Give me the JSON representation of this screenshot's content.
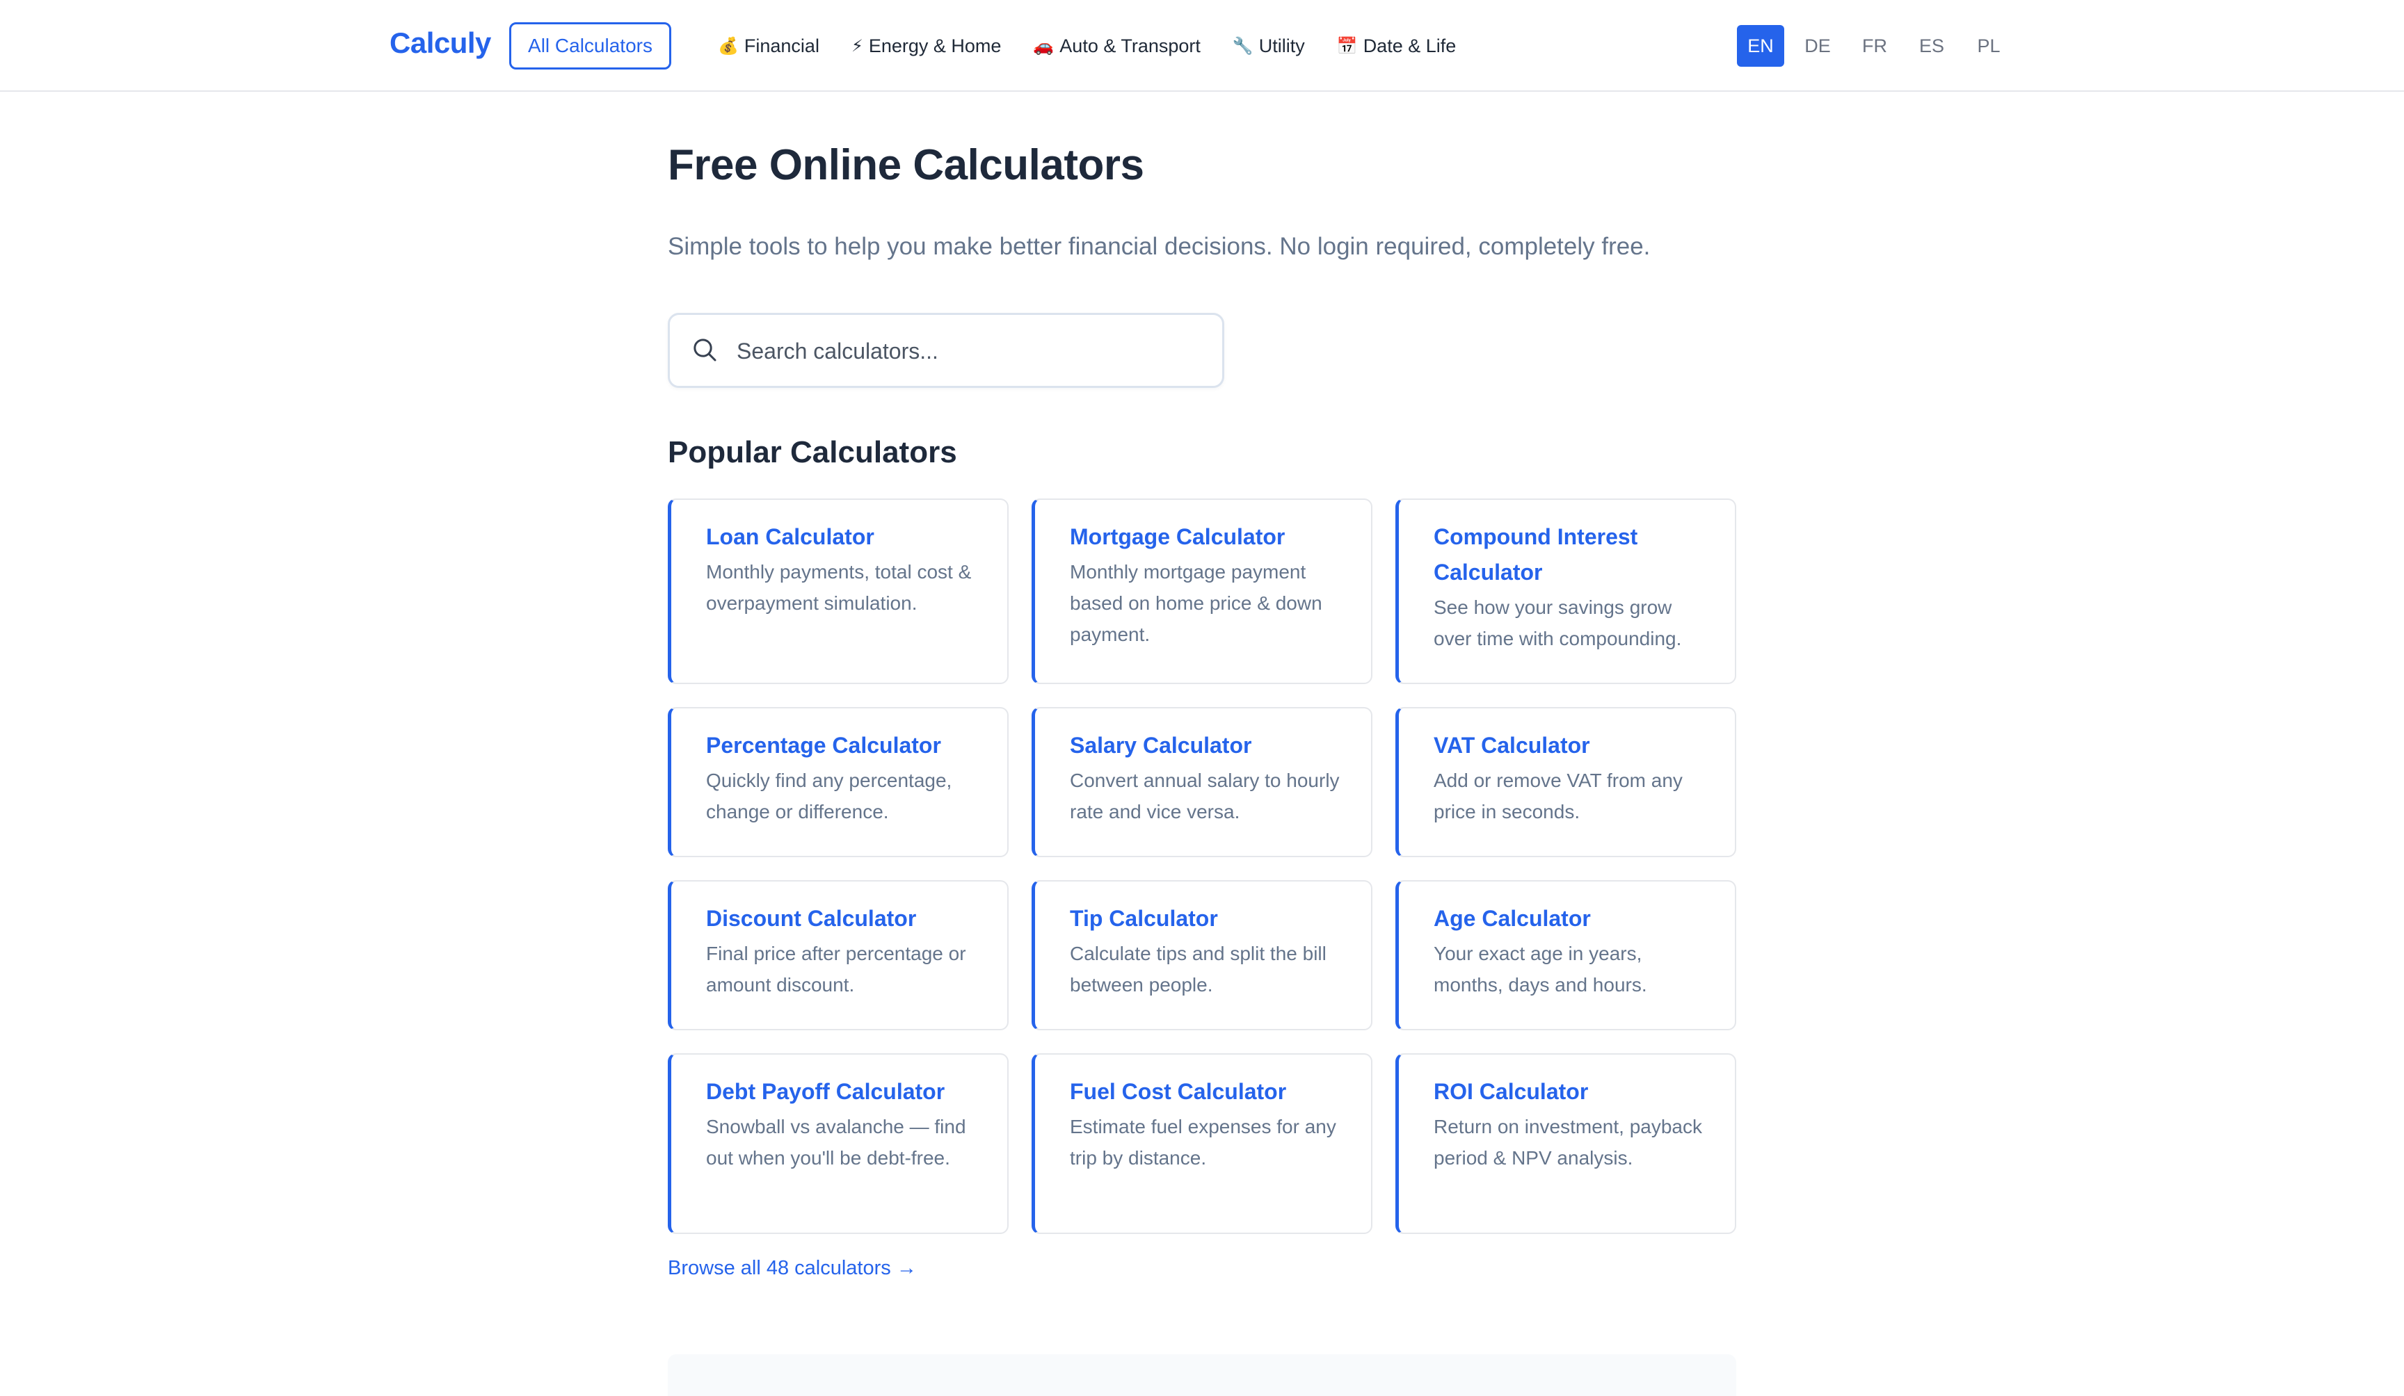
{
  "header": {
    "brand": "Calculy",
    "all_calculators": "All Calculators",
    "nav": [
      {
        "icon": "money-bag-icon",
        "glyph": "💰",
        "label": "Financial"
      },
      {
        "icon": "lightning-icon",
        "glyph": "⚡",
        "label": "Energy & Home"
      },
      {
        "icon": "car-icon",
        "glyph": "🚗",
        "label": "Auto & Transport"
      },
      {
        "icon": "wrench-icon",
        "glyph": "🔧",
        "label": "Utility"
      },
      {
        "icon": "calendar-icon",
        "glyph": "📅",
        "label": "Date & Life"
      }
    ],
    "languages": [
      "EN",
      "DE",
      "FR",
      "ES",
      "PL"
    ],
    "active_language": "EN"
  },
  "main": {
    "title": "Free Online Calculators",
    "subtitle": "Simple tools to help you make better financial decisions. No login required, completely free.",
    "search": {
      "placeholder": "Search calculators...",
      "value": ""
    },
    "popular_title": "Popular Calculators",
    "cards": [
      {
        "title": "Loan Calculator",
        "desc": "Monthly payments, total cost & overpayment simulation."
      },
      {
        "title": "Mortgage Calculator",
        "desc": "Monthly mortgage payment based on home price & down payment."
      },
      {
        "title": "Compound Interest Calculator",
        "desc": "See how your savings grow over time with compounding."
      },
      {
        "title": "Percentage Calculator",
        "desc": "Quickly find any percentage, change or difference."
      },
      {
        "title": "Salary Calculator",
        "desc": "Convert annual salary to hourly rate and vice versa."
      },
      {
        "title": "VAT Calculator",
        "desc": "Add or remove VAT from any price in seconds."
      },
      {
        "title": "Discount Calculator",
        "desc": "Final price after percentage or amount discount."
      },
      {
        "title": "Tip Calculator",
        "desc": "Calculate tips and split the bill between people."
      },
      {
        "title": "Age Calculator",
        "desc": "Your exact age in years, months, days and hours."
      },
      {
        "title": "Debt Payoff Calculator",
        "desc": "Snowball vs avalanche — find out when you'll be debt-free."
      },
      {
        "title": "Fuel Cost Calculator",
        "desc": "Estimate fuel expenses for any trip by distance."
      },
      {
        "title": "ROI Calculator",
        "desc": "Return on investment, payback period & NPV analysis."
      }
    ],
    "browse_all": "Browse all 48 calculators →"
  },
  "colors": {
    "accent": "#2563eb",
    "title": "#1e293b",
    "muted": "#64748b",
    "border": "#e5e7eb"
  }
}
